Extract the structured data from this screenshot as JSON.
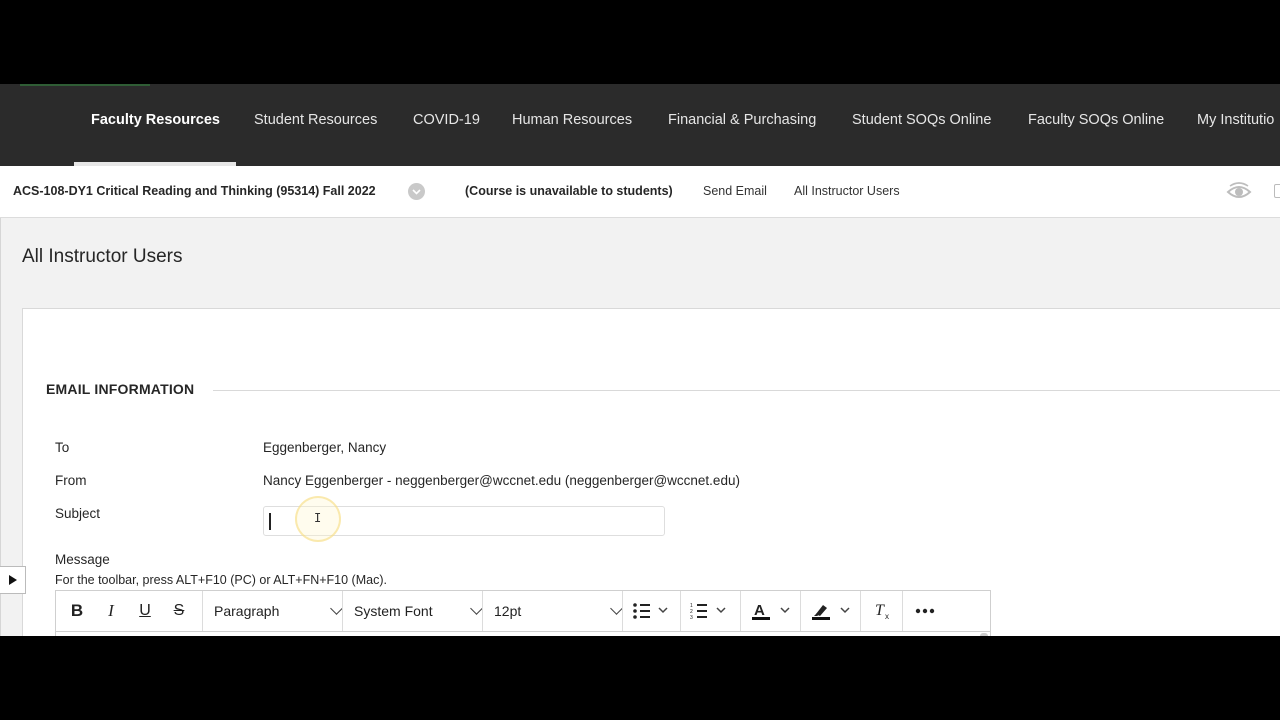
{
  "nav": {
    "items": [
      {
        "label": "Faculty Resources",
        "active": true
      },
      {
        "label": "Student Resources",
        "active": false
      },
      {
        "label": "COVID-19",
        "active": false
      },
      {
        "label": "Human Resources",
        "active": false
      },
      {
        "label": "Financial & Purchasing",
        "active": false
      },
      {
        "label": "Student SOQs Online",
        "active": false
      },
      {
        "label": "Faculty SOQs Online",
        "active": false
      },
      {
        "label": "My Institutio",
        "active": false
      }
    ]
  },
  "course": {
    "title": "ACS-108-DY1 Critical Reading and Thinking (95314) Fall 2022",
    "status": "(Course is unavailable to students)",
    "breadcrumbs": [
      "Send Email",
      "All Instructor Users"
    ]
  },
  "page": {
    "title": "All Instructor Users",
    "section_title": "EMAIL INFORMATION"
  },
  "form": {
    "to_label": "To",
    "to_value": "Eggenberger, Nancy",
    "from_label": "From",
    "from_value": "Nancy Eggenberger - neggenberger@wccnet.edu (neggenberger@wccnet.edu)",
    "subject_label": "Subject",
    "subject_value": "",
    "message_label": "Message",
    "toolbar_hint": "For the toolbar, press ALT+F10 (PC) or ALT+FN+F10 (Mac)."
  },
  "editor_toolbar": {
    "bold": "B",
    "italic": "I",
    "underline": "U",
    "strikethrough": "S",
    "block_format": "Paragraph",
    "font_family": "System Font",
    "font_size": "12pt"
  },
  "icons": {
    "course_menu": "chevron-down-circle-icon",
    "student_preview": "eye-icon",
    "side_toggle": "play-right-icon"
  },
  "colors": {
    "nav_background": "#2b2b2b",
    "content_background": "#f2f2f2"
  }
}
